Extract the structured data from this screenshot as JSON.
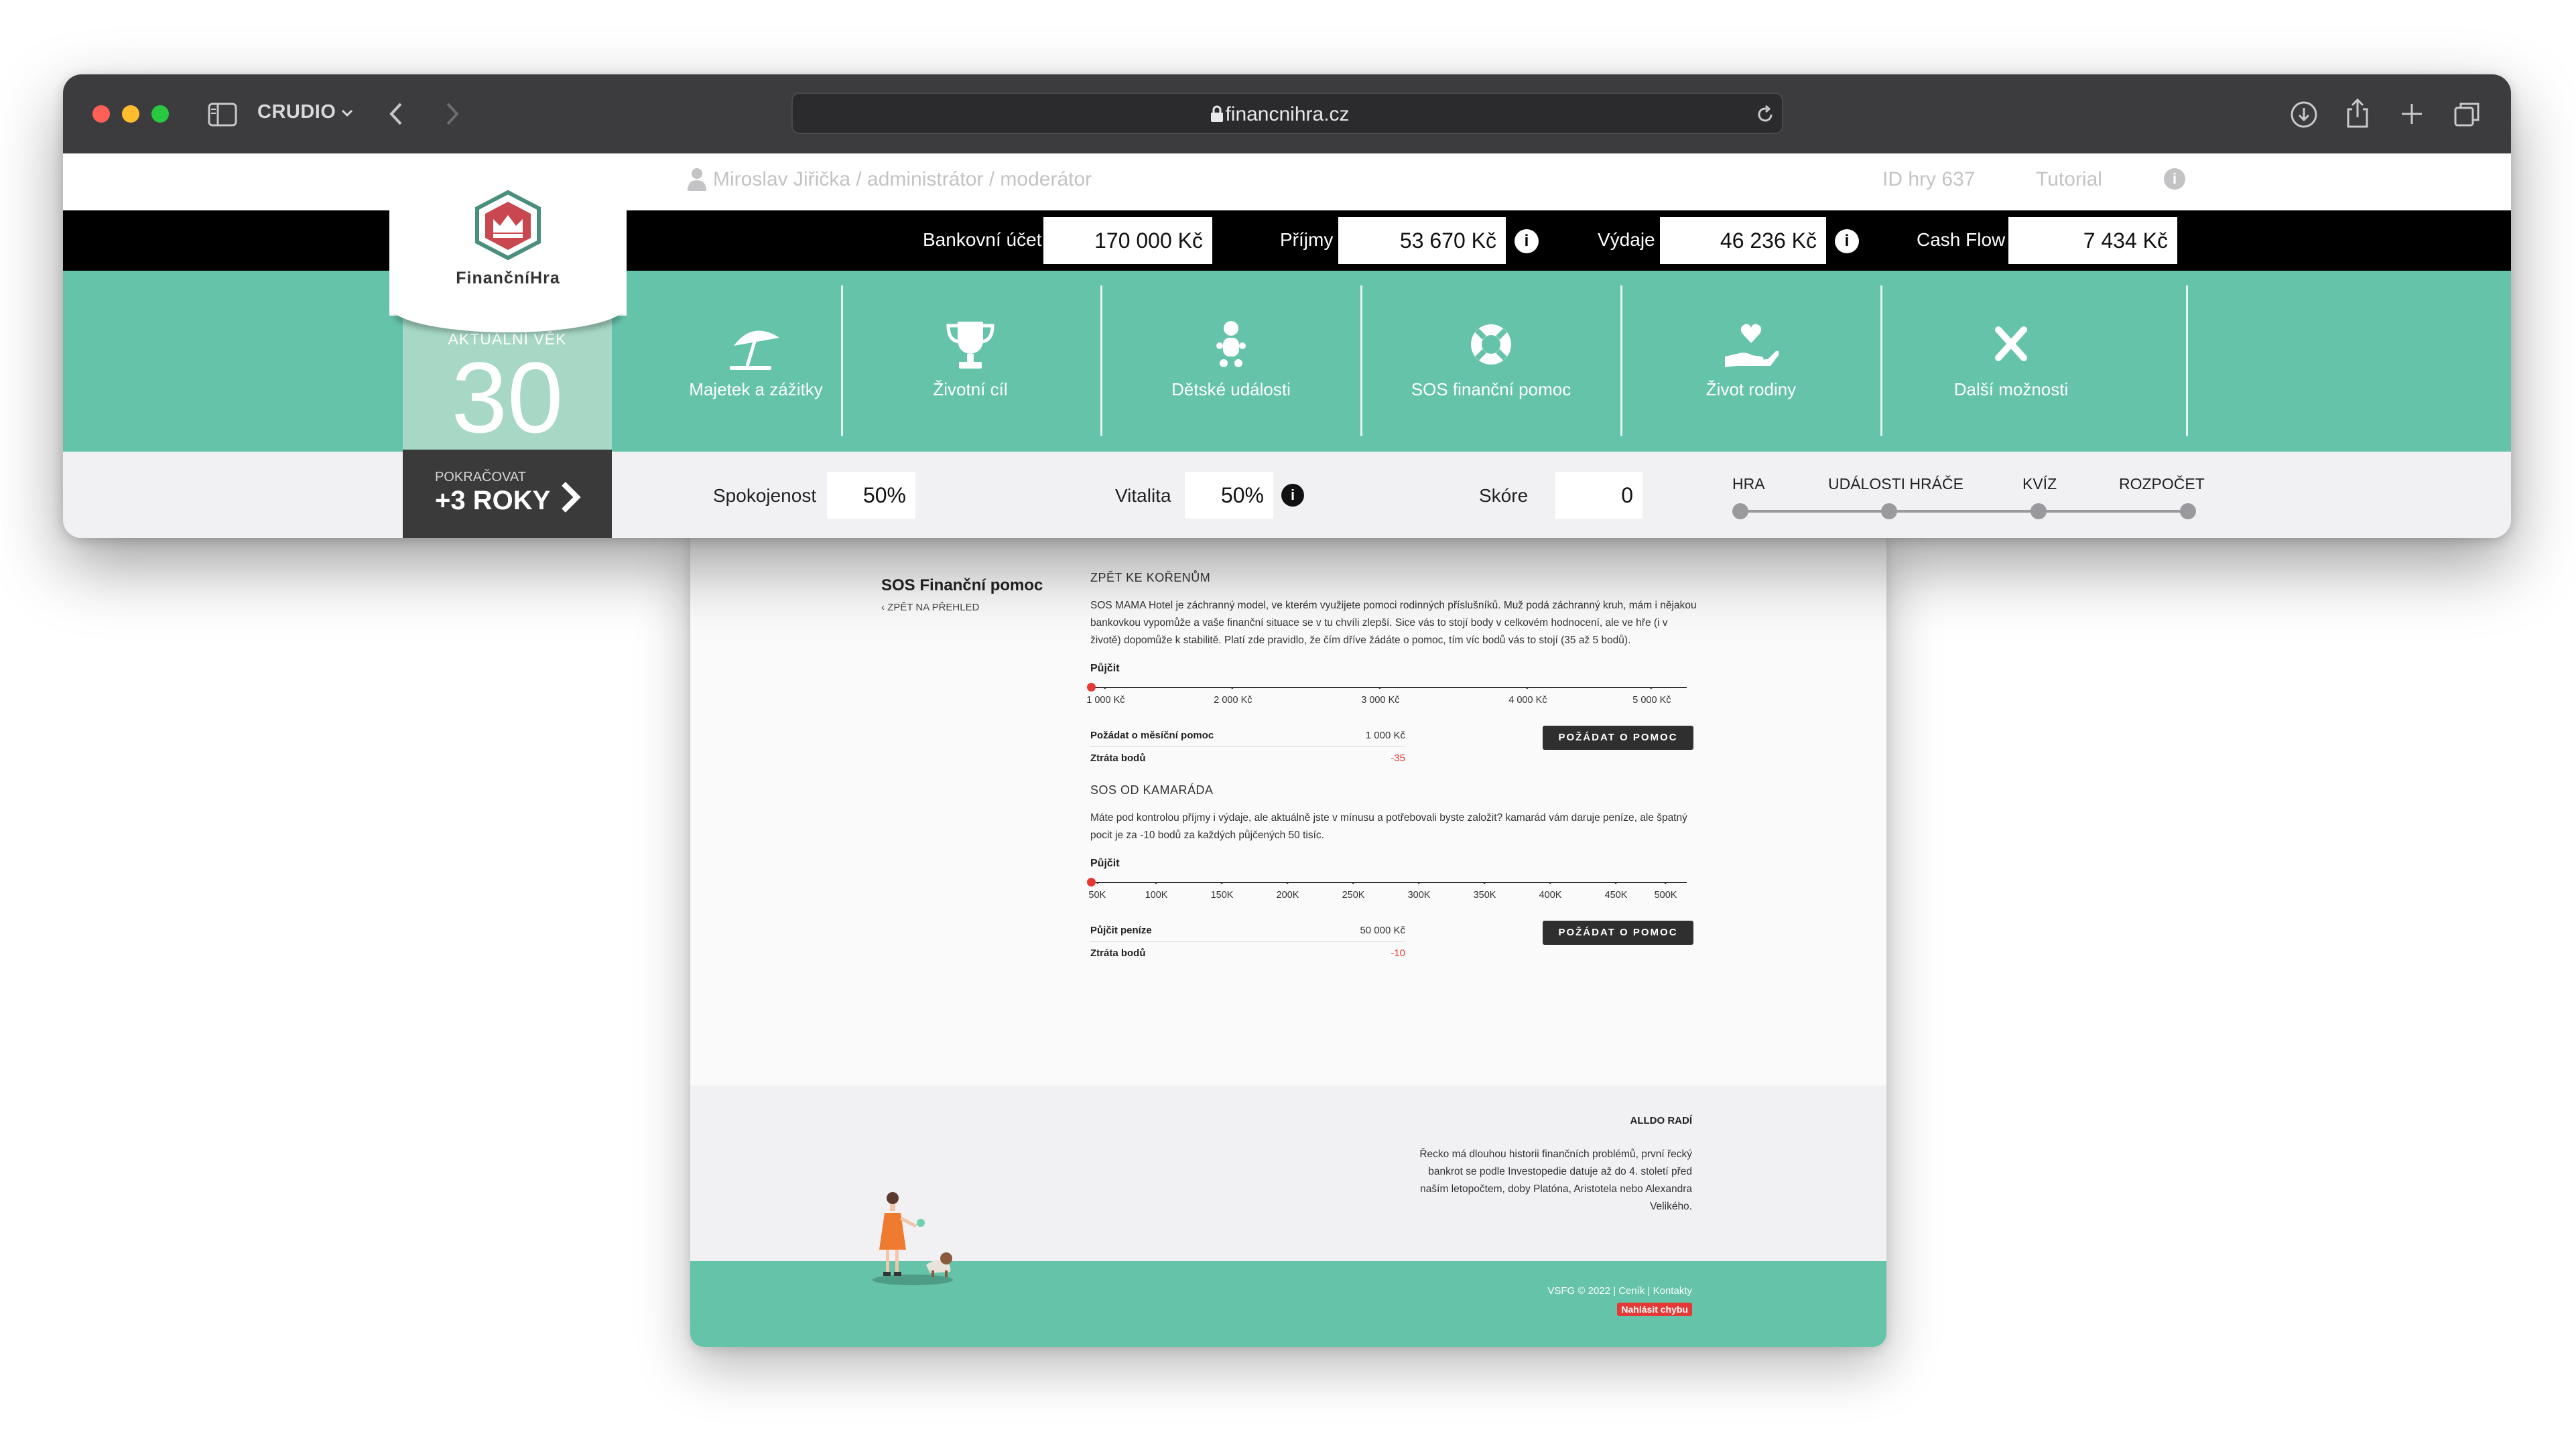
{
  "browser": {
    "tab_name": "CRUDIO",
    "url": "financnihra.cz"
  },
  "header": {
    "user": "Miroslav Jiřička / administrátor / moderátor",
    "game_id": "ID hry 637",
    "tutorial": "Tutorial"
  },
  "logo": {
    "text": "FinančníHra"
  },
  "finance": {
    "bank_label": "Bankovní účet",
    "bank_value": "170 000 Kč",
    "income_label": "Příjmy",
    "income_value": "53 670 Kč",
    "expense_label": "Výdaje",
    "expense_value": "46 236 Kč",
    "cashflow_label": "Cash Flow",
    "cashflow_value": "7 434 Kč"
  },
  "age": {
    "label": "AKTUÁLNÍ VĚK",
    "value": "30",
    "continue_label": "POKRAČOVAT",
    "continue_value": "+3 ROKY"
  },
  "nav": [
    {
      "label": "Majetek a zážitky",
      "icon": "umbrella-icon"
    },
    {
      "label": "Životní cíl",
      "icon": "trophy-icon"
    },
    {
      "label": "Dětské události",
      "icon": "baby-icon"
    },
    {
      "label": "SOS finanční pomoc",
      "icon": "lifebuoy-icon"
    },
    {
      "label": "Život rodiny",
      "icon": "heart-hand-icon"
    },
    {
      "label": "Další možnosti",
      "icon": "close-icon"
    }
  ],
  "stats": {
    "satisfaction_label": "Spokojenost",
    "satisfaction_value": "50%",
    "vitality_label": "Vitalita",
    "vitality_value": "50%",
    "score_label": "Skóre",
    "score_value": "0"
  },
  "progress": {
    "steps": [
      "HRA",
      "UDÁLOSTI HRÁČE",
      "KVÍZ",
      "ROZPOČET"
    ]
  },
  "content": {
    "title": "SOS Finanční pomoc",
    "back": "‹ ZPĚT NA PŘEHLED",
    "section1": {
      "heading": "ZPĚT KE KOŘENŮM",
      "text": "SOS MAMA Hotel je záchranný model, ve kterém využijete pomoci rodinných příslušníků. Muž podá záchranný kruh, mám i nějakou bankovkou vypomůže a vaše finanční situace se v tu chvíli zlepší. Sice vás to stojí body v celkovém hodnocení, ale ve hře (i v životě) dopomůže k stabilitě. Platí zde pravidlo, že čím dříve žádáte o pomoc, tím víc bodů vás to stojí (35 až 5 bodů).",
      "borrow_label": "Půjčit",
      "ticks": [
        "1 000 Kč",
        "2 000 Kč",
        "3 000 Kč",
        "4 000 Kč",
        "5 000 Kč"
      ],
      "request_label": "Požádat o měsíční pomoc",
      "request_value": "1 000 Kč",
      "loss_label": "Ztráta bodů",
      "loss_value": "-35",
      "button": "POŽÁDAT O POMOC"
    },
    "section2": {
      "heading": "SOS OD KAMARÁDA",
      "text": "Máte pod kontrolou příjmy i výdaje, ale aktuálně jste v mínusu a potřebovali byste založit? kamarád vám daruje peníze, ale špatný pocit je za -10 bodů za každých půjčených 50 tisíc.",
      "borrow_label": "Půjčit",
      "ticks": [
        "50K",
        "100K",
        "150K",
        "200K",
        "250K",
        "300K",
        "350K",
        "400K",
        "450K",
        "500K"
      ],
      "request_label": "Půjčit peníze",
      "request_value": "50 000 Kč",
      "loss_label": "Ztráta bodů",
      "loss_value": "-10",
      "button": "POŽÁDAT O POMOC"
    }
  },
  "tips": {
    "title": "ALLDO RADÍ",
    "text": "Řecko má dlouhou historii finančních problémů, první řecký bankrot se podle Investopedie datuje až do 4. století před naším letopočtem, doby Platóna, Aristotela nebo Alexandra Velikého."
  },
  "footer": {
    "links": "VSFG © 2022 | Ceník | Kontakty",
    "report": "Nahlásit chybu"
  },
  "colors": {
    "accent_green": "#64c3a9",
    "light_green": "#a6d8c5",
    "danger_red": "#e53935"
  }
}
